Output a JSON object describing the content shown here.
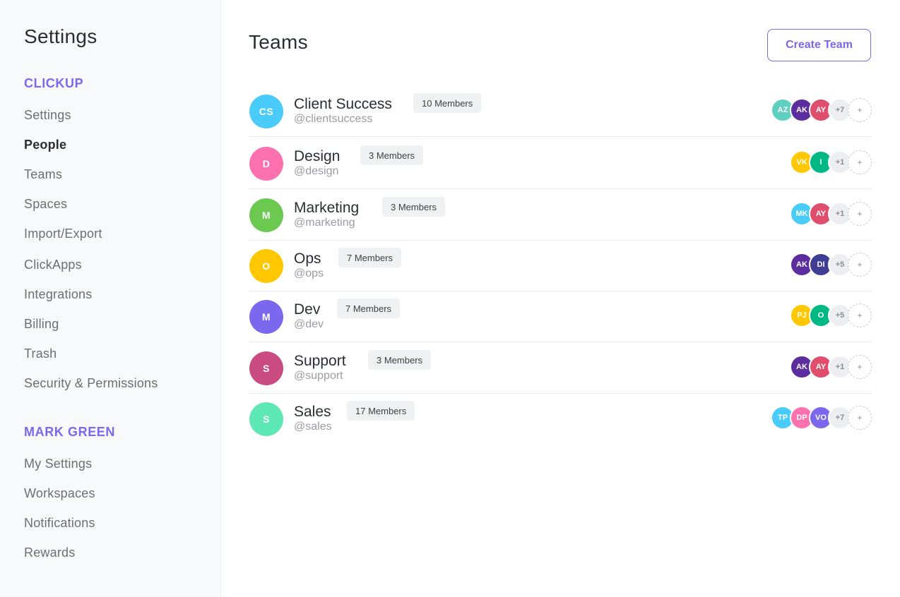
{
  "sidebar": {
    "title": "Settings",
    "sections": [
      {
        "title": "CLICKUP",
        "items": [
          "Settings",
          "People",
          "Teams",
          "Spaces",
          "Import/Export",
          "ClickApps",
          "Integrations",
          "Billing",
          "Trash",
          "Security & Permissions"
        ]
      },
      {
        "title": "MARK GREEN",
        "items": [
          "My Settings",
          "Workspaces",
          "Notifications",
          "Rewards"
        ]
      }
    ],
    "active_item": "People"
  },
  "main": {
    "title": "Teams",
    "create_button": "Create Team",
    "add_icon_glyph": "+",
    "teams": [
      {
        "initials": "CS",
        "color": "#49ccf9",
        "name": "Client Success",
        "handle": "@clientsuccess",
        "members": "10 Members",
        "avatars": [
          {
            "initials": "AZ",
            "color": "#5fcfc1"
          },
          {
            "initials": "AK",
            "color": "#5b2d9e"
          },
          {
            "initials": "AY",
            "color": "#e04e6d"
          }
        ],
        "more": "+7"
      },
      {
        "initials": "D",
        "color": "#fd71af",
        "name": "Design",
        "handle": "@design",
        "members": "3 Members",
        "avatars": [
          {
            "initials": "VK",
            "color": "#ffc800"
          },
          {
            "initials": "I",
            "color": "#00b884"
          }
        ],
        "more": "+1"
      },
      {
        "initials": "M",
        "color": "#6bc950",
        "name": "Marketing",
        "handle": "@marketing",
        "members": "3 Members",
        "avatars": [
          {
            "initials": "MK",
            "color": "#49ccf9"
          },
          {
            "initials": "AY",
            "color": "#e04e6d"
          }
        ],
        "more": "+1"
      },
      {
        "initials": "O",
        "color": "#ffc800",
        "name": "Ops",
        "handle": "@ops",
        "members": "7 Members",
        "avatars": [
          {
            "initials": "AK",
            "color": "#5b2d9e"
          },
          {
            "initials": "DI",
            "color": "#3f3d94"
          }
        ],
        "more": "+5"
      },
      {
        "initials": "M",
        "color": "#7b68ee",
        "name": "Dev",
        "handle": "@dev",
        "members": "7 Members",
        "avatars": [
          {
            "initials": "PJ",
            "color": "#ffc800"
          },
          {
            "initials": "O",
            "color": "#00b884"
          }
        ],
        "more": "+5"
      },
      {
        "initials": "S",
        "color": "#c94b82",
        "name": "Support",
        "handle": "@support",
        "members": "3 Members",
        "avatars": [
          {
            "initials": "AK",
            "color": "#5b2d9e"
          },
          {
            "initials": "AY",
            "color": "#e04e6d"
          }
        ],
        "more": "+1"
      },
      {
        "initials": "S",
        "color": "#5ee8b5",
        "name": "Sales",
        "handle": "@sales",
        "members": "17 Members",
        "avatars": [
          {
            "initials": "TP",
            "color": "#49ccf9"
          },
          {
            "initials": "DP",
            "color": "#fd71af"
          },
          {
            "initials": "VO",
            "color": "#7b68ee"
          }
        ],
        "more": "+7"
      }
    ]
  }
}
